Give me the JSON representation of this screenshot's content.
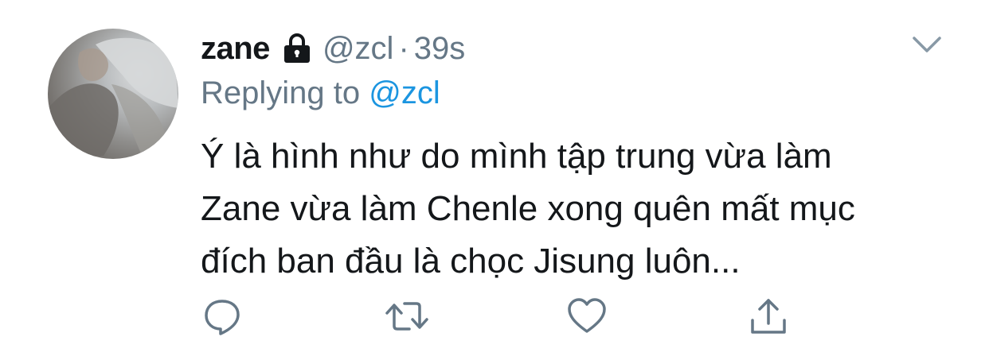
{
  "tweet": {
    "author": {
      "display_name": "zane",
      "handle": "@zcl",
      "avatar_icon": "avatar-photo",
      "protected_icon": "lock-icon"
    },
    "separator": "·",
    "timestamp": "39s",
    "replying_to": {
      "prefix": "Replying to",
      "mention": "@zcl"
    },
    "text_lines": [
      "Ý là hình như do mình tập trung vừa làm",
      "Zane vừa làm Chenle xong quên mất mục",
      "đích ban đầu là chọc Jisung luôn..."
    ],
    "actions": [
      {
        "name": "reply",
        "icon": "reply-icon"
      },
      {
        "name": "retweet",
        "icon": "retweet-icon"
      },
      {
        "name": "like",
        "icon": "heart-icon"
      },
      {
        "name": "share",
        "icon": "share-icon"
      }
    ],
    "menu_icon": "chevron-down-icon"
  },
  "colors": {
    "primary_text": "#14171a",
    "secondary_text": "#657786",
    "link": "#1b95e0",
    "icon": "#657786",
    "background": "#ffffff"
  }
}
